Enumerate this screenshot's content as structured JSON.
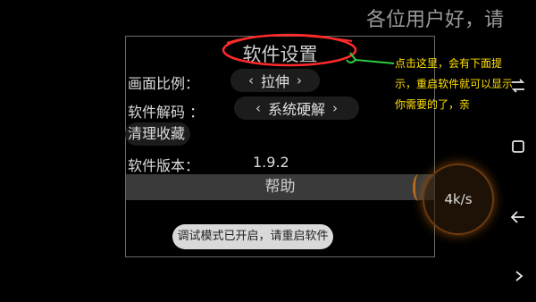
{
  "marquee_text": "各位用户好，请",
  "dialog": {
    "title": "软件设置",
    "rows": [
      {
        "label": "画面比例：",
        "value": "拉伸"
      },
      {
        "label": "软件解码 ：",
        "value": "系统硬解"
      }
    ],
    "clear_cache_label": "清理收藏",
    "version_label": "软件版本：",
    "version_value": "1.9.2",
    "help_button_label": "帮助"
  },
  "toast_text": "调试模式已开启，请重启软件",
  "speed_text": "4k/s",
  "annotation": {
    "text": "点击这里，会有下面提示，重启软件就可以显示你需要的了，亲",
    "color": "#ffe100",
    "circle_color": "#ff2a2a",
    "arrow_color": "#2ecc40"
  },
  "side_nav": {
    "top_icon": "swap-icon",
    "square_icon": "square-icon",
    "back_icon": "back-arrow-icon",
    "forward_icon": "chevron-right-icon"
  },
  "icons": {
    "left": "‹",
    "right": "›"
  }
}
